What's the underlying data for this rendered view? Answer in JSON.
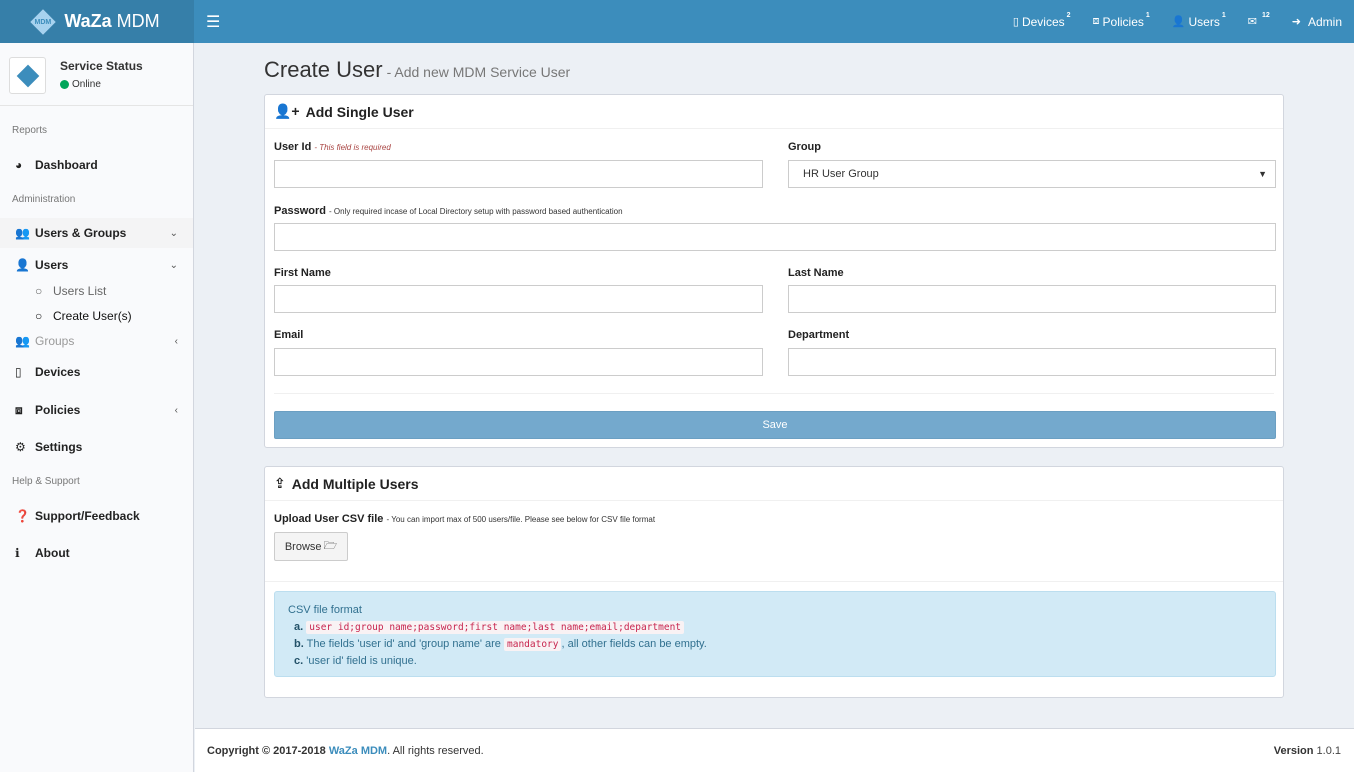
{
  "brand": {
    "bold": "WaZa",
    "rest": "MDM",
    "logo_text": "MDM"
  },
  "topnav": {
    "devices": {
      "label": "Devices",
      "count": "2"
    },
    "policies": {
      "label": "Policies",
      "count": "1"
    },
    "users": {
      "label": "Users",
      "count": "1"
    },
    "messages": {
      "count": "12"
    },
    "admin": {
      "label": "Admin"
    }
  },
  "sidebar": {
    "service": {
      "title": "Service Status",
      "status": "Online"
    },
    "headers": {
      "reports": "Reports",
      "admin": "Administration",
      "help": "Help & Support"
    },
    "items": {
      "dashboard": "Dashboard",
      "users_groups": "Users & Groups",
      "users": "Users",
      "users_list": "Users List",
      "create_users": "Create User(s)",
      "groups": "Groups",
      "devices": "Devices",
      "policies": "Policies",
      "settings": "Settings",
      "support": "Support/Feedback",
      "about": "About"
    }
  },
  "page": {
    "title": "Create User",
    "subtitle": "- Add new MDM Service User"
  },
  "single": {
    "header": "Add Single User",
    "user_id_label": "User Id",
    "user_id_required": "- This field is required",
    "group_label": "Group",
    "group_selected": "HR User Group",
    "password_label": "Password",
    "password_hint": "- Only required incase of Local Directory setup with password based authentication",
    "first_name_label": "First Name",
    "last_name_label": "Last Name",
    "email_label": "Email",
    "department_label": "Department",
    "save_label": "Save"
  },
  "multiple": {
    "header": "Add Multiple Users",
    "upload_label": "Upload User CSV file",
    "upload_hint": "- You can import max of 500 users/file. Please see below for CSV file format",
    "browse_label": "Browse",
    "csv_title": "CSV file format",
    "a_prefix": "a.",
    "a_code": "user id;group name;password;first name;last name;email;department",
    "b_prefix": "b.",
    "b_text1": "The fields 'user id' and 'group name' are",
    "b_code": "mandatory",
    "b_text2": ", all other fields can be empty.",
    "c_prefix": "c.",
    "c_text": "'user id' field is unique."
  },
  "footer": {
    "copyright": "Copyright © 2017-2018",
    "link": "WaZa MDM",
    "rights": ". All rights reserved.",
    "version_label": "Version",
    "version": "1.0.1"
  }
}
